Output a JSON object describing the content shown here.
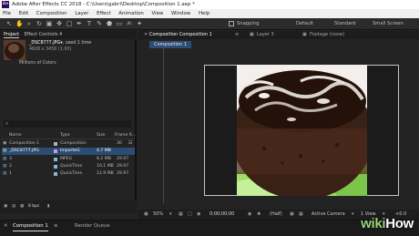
{
  "window": {
    "logo": "Ae",
    "title": "Adobe After Effects CC 2018 - C:\\Users\\gabri\\Desktop\\Composition 1.aep *"
  },
  "menu": [
    "File",
    "Edit",
    "Composition",
    "Layer",
    "Effect",
    "Animation",
    "View",
    "Window",
    "Help"
  ],
  "toolbar": {
    "snapping_label": "Snapping",
    "workspaces": [
      "Default",
      "Standard",
      "Small Screen"
    ]
  },
  "project_panel": {
    "tabs": [
      "Project",
      "Effect Controls 4"
    ],
    "selected_item": "_DSC8777.JPG",
    "used_text": ", used 1 time",
    "dimensions": "4608 x 3456 (1.00)",
    "colors": "Millions of Colors",
    "columns": [
      "Name",
      "Type",
      "Size",
      "Frame R..."
    ],
    "items": [
      {
        "name": "Composition 1",
        "type": "Composition",
        "size": "",
        "frame_rate": "30",
        "tag_color": "#b9a7d6"
      },
      {
        "name": "_DSC8777.JPG",
        "type": "ImporteG",
        "size": "4.7 MB",
        "frame_rate": "",
        "tag_color": "#b9a7d6",
        "selected": true
      },
      {
        "name": "3",
        "type": "MPEG",
        "size": "8.2 MB",
        "frame_rate": "29.97",
        "tag_color": "#8ab4d8"
      },
      {
        "name": "2",
        "type": "QuickTime",
        "size": "10.1 MB",
        "frame_rate": "29.97",
        "tag_color": "#8ab4d8"
      },
      {
        "name": "1",
        "type": "QuickTime",
        "size": "11.9 MB",
        "frame_rate": "29.97",
        "tag_color": "#8ab4d8"
      }
    ],
    "footer_bpc": "8 bpc"
  },
  "viewer": {
    "tabs": [
      {
        "label": "Composition Composition 1",
        "active": true
      },
      {
        "label": "Layer 3",
        "active": false
      },
      {
        "label": "Footage (none)",
        "active": false
      }
    ],
    "active_comp_label": "Composition 1",
    "zoom": "50%",
    "timecode": "0;00;00;00",
    "resolution": "(Half)",
    "camera": "Active Camera",
    "views": "1 View",
    "offset": "+0.0"
  },
  "timeline": {
    "tabs": [
      "Composition 1",
      "Render Queue"
    ]
  },
  "watermark": {
    "prefix": "wiki",
    "suffix": "How"
  }
}
